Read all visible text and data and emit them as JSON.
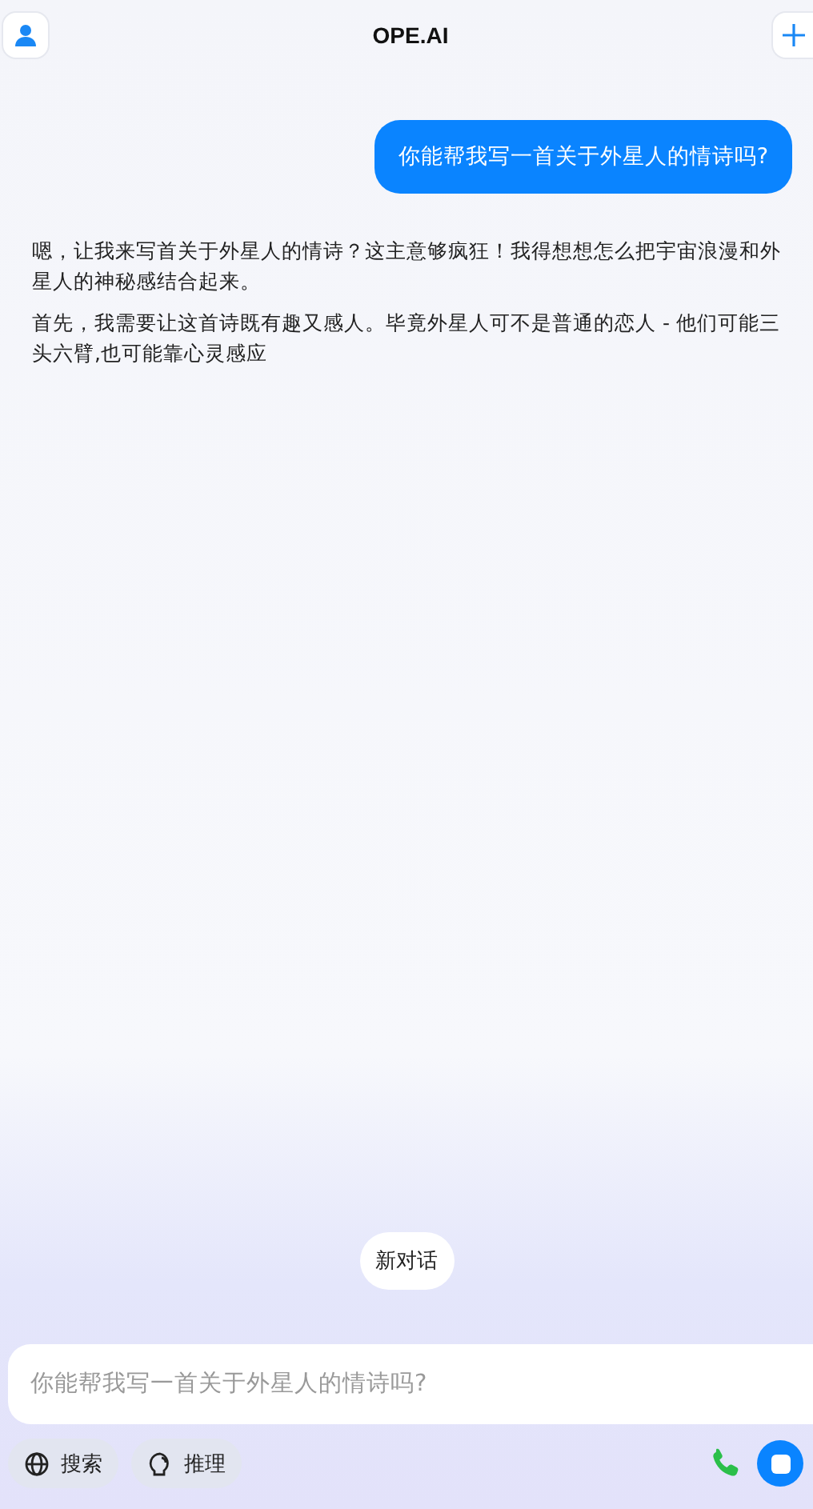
{
  "header": {
    "title": "OPE.AI"
  },
  "user_message": "你能帮我写一首关于外星人的情诗吗?",
  "reply_paragraphs": [
    "嗯，让我来写首关于外星人的情诗？这主意够疯狂！我得想想怎么把宇宙浪漫和外星人的神秘感结合起来。",
    "首先，我需要让这首诗既有趣又感人。毕竟外星人可不是普通的恋人 - 他们可能三头六臂,也可能靠心灵感应"
  ],
  "new_chat": "新对话",
  "composer": {
    "placeholder": "你能帮我写一首关于外星人的情诗吗?",
    "tools": [
      {
        "kind": "search",
        "label": "搜索"
      },
      {
        "kind": "reason",
        "label": "推理"
      }
    ]
  }
}
